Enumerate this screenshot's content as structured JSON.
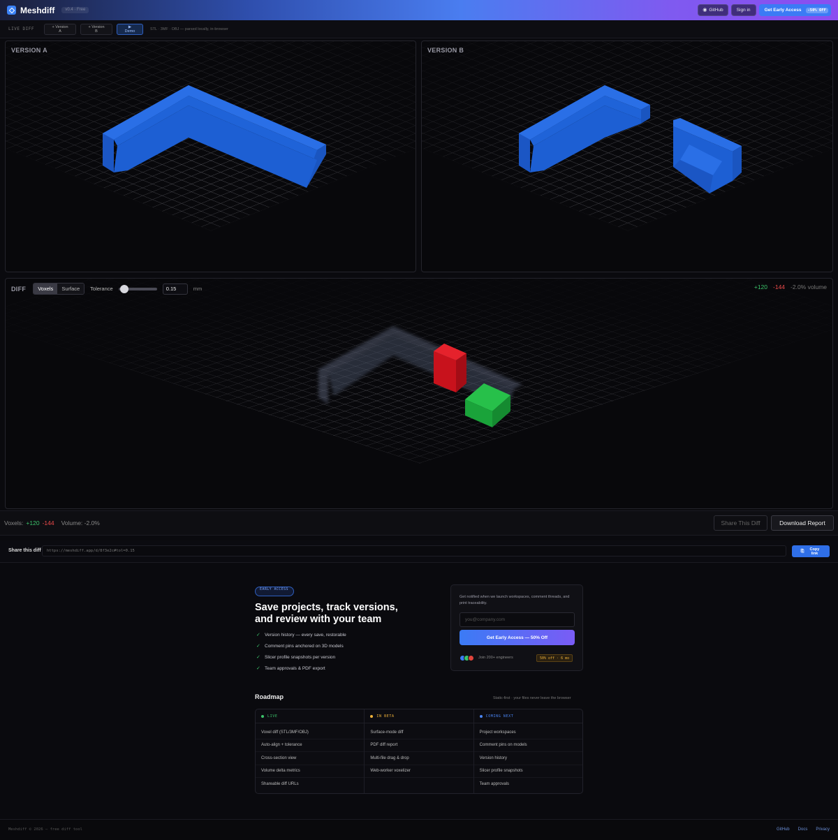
{
  "header": {
    "brand": "Meshdiff",
    "version_pill": "v0.4 · Free",
    "github_label": "GitHub",
    "signin_label": "Sign in",
    "cta_label": "Get Early Access",
    "cta_badge": "-50% OFF"
  },
  "toolbar": {
    "label": "LIVE DIFF",
    "buttons": [
      {
        "label": "+ Version A"
      },
      {
        "label": "+ Version B"
      },
      {
        "label": "▶ Demo"
      }
    ],
    "note": "STL · 3MF · OBJ — parsed locally, in-browser"
  },
  "viewports": {
    "a_label": "VERSION A",
    "b_label": "VERSION B",
    "diff_label": "DIFF"
  },
  "diff": {
    "modes": [
      "Voxels",
      "Surface"
    ],
    "active_mode": "Voxels",
    "tolerance_label": "Tolerance",
    "tolerance_value": "0.15",
    "tolerance_unit": "mm",
    "tolerance_slider_fraction": 0.1,
    "added": "+120",
    "removed": "-144",
    "volume": "-2.0% volume"
  },
  "status": {
    "voxels_label": "Voxels:",
    "added": "+120",
    "removed": "-144",
    "volume_label": "Volume: -2.0%",
    "share_button": "Share This Diff",
    "download_button": "Download Report"
  },
  "share": {
    "title": "Share this diff",
    "url": "https://meshdiff.app/d/8f3e2c#tol=0.15",
    "copy_label": "Copy link"
  },
  "early_access": {
    "pill": "EARLY ACCESS",
    "title": "Save projects, track versions, and review with your team",
    "features": [
      "Version history — every save, restorable",
      "Comment pins anchored on 3D models",
      "Slicer profile snapshots per version",
      "Team approvals & PDF export"
    ],
    "signup_text": "Get notified when we launch workspaces, comment threads, and print traceability.",
    "email_placeholder": "you@company.com",
    "signup_button": "Get Early Access — 50% Off",
    "join_text": "Join 200+ engineers",
    "offer_badge": "50% off · 6 mo"
  },
  "roadmap": {
    "title": "Roadmap",
    "note": "Static-first · your files never leave the browser",
    "columns": [
      {
        "status": "LIVE",
        "color": "#3cc46b",
        "items": [
          "Voxel diff (STL/3MF/OBJ)",
          "Auto-align + tolerance",
          "Cross-section view",
          "Volume delta metrics",
          "Shareable diff URLs"
        ]
      },
      {
        "status": "IN BETA",
        "color": "#f0b33a",
        "items": [
          "Surface-mode diff",
          "PDF diff report",
          "Multi-file drag & drop",
          "Web-worker voxelizer"
        ]
      },
      {
        "status": "COMING NEXT",
        "color": "#4a86f5",
        "items": [
          "Project workspaces",
          "Comment pins on models",
          "Version history",
          "Slicer profile snapshots",
          "Team approvals"
        ]
      }
    ]
  },
  "footer": {
    "copyright": "Meshdiff © 2026 — free diff tool",
    "links": [
      "GitHub",
      "Docs",
      "Privacy"
    ]
  },
  "colors": {
    "accent": "#3b7bf5",
    "model_blue": "#1f63d8",
    "added_green": "#1faa3c",
    "removed_red": "#d0141e"
  }
}
